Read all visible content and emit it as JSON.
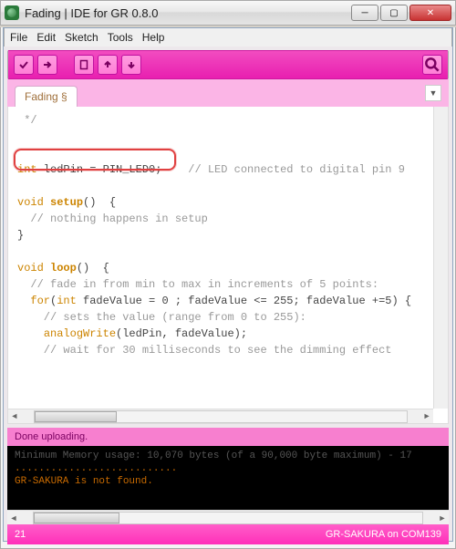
{
  "window": {
    "title": "Fading | IDE for GR 0.8.0"
  },
  "menu": {
    "file": "File",
    "edit": "Edit",
    "sketch": "Sketch",
    "tools": "Tools",
    "help": "Help"
  },
  "toolbar": {
    "verify": "verify",
    "upload": "upload",
    "new": "new",
    "open": "open",
    "save": "save",
    "serial": "serial-monitor"
  },
  "tabs": {
    "active": "Fading §"
  },
  "code": {
    "l1": " */",
    "l2": "",
    "l3a": "int",
    "l3b": " ledPin = PIN_LED0;    ",
    "l3c": "// LED connected to digital pin 9",
    "l4": "",
    "l5a": "void ",
    "l5b": "setup",
    "l5c": "()  {",
    "l6": "  // nothing happens in setup",
    "l7": "}",
    "l8": "",
    "l9a": "void ",
    "l9b": "loop",
    "l9c": "()  {",
    "l10": "  // fade in from min to max in increments of 5 points:",
    "l11a": "  for",
    "l11b": "(",
    "l11c": "int",
    "l11d": " fadeValue = 0 ; fadeValue <= 255; fadeValue +=5) {",
    "l12": "    // sets the value (range from 0 to 255):",
    "l13a": "    ",
    "l13b": "analogWrite",
    "l13c": "(ledPin, fadeValue);",
    "l14": "    // wait for 30 milliseconds to see the dimming effect"
  },
  "status": {
    "upload": "Done uploading."
  },
  "console": {
    "line1": "Minimum Memory usage: 10,070 bytes (of a 90,000 byte maximum) - 17",
    "line2": "...........................",
    "line3": "GR-SAKURA is not found."
  },
  "statusbar": {
    "line": "21",
    "port": "GR-SAKURA on COM139"
  }
}
